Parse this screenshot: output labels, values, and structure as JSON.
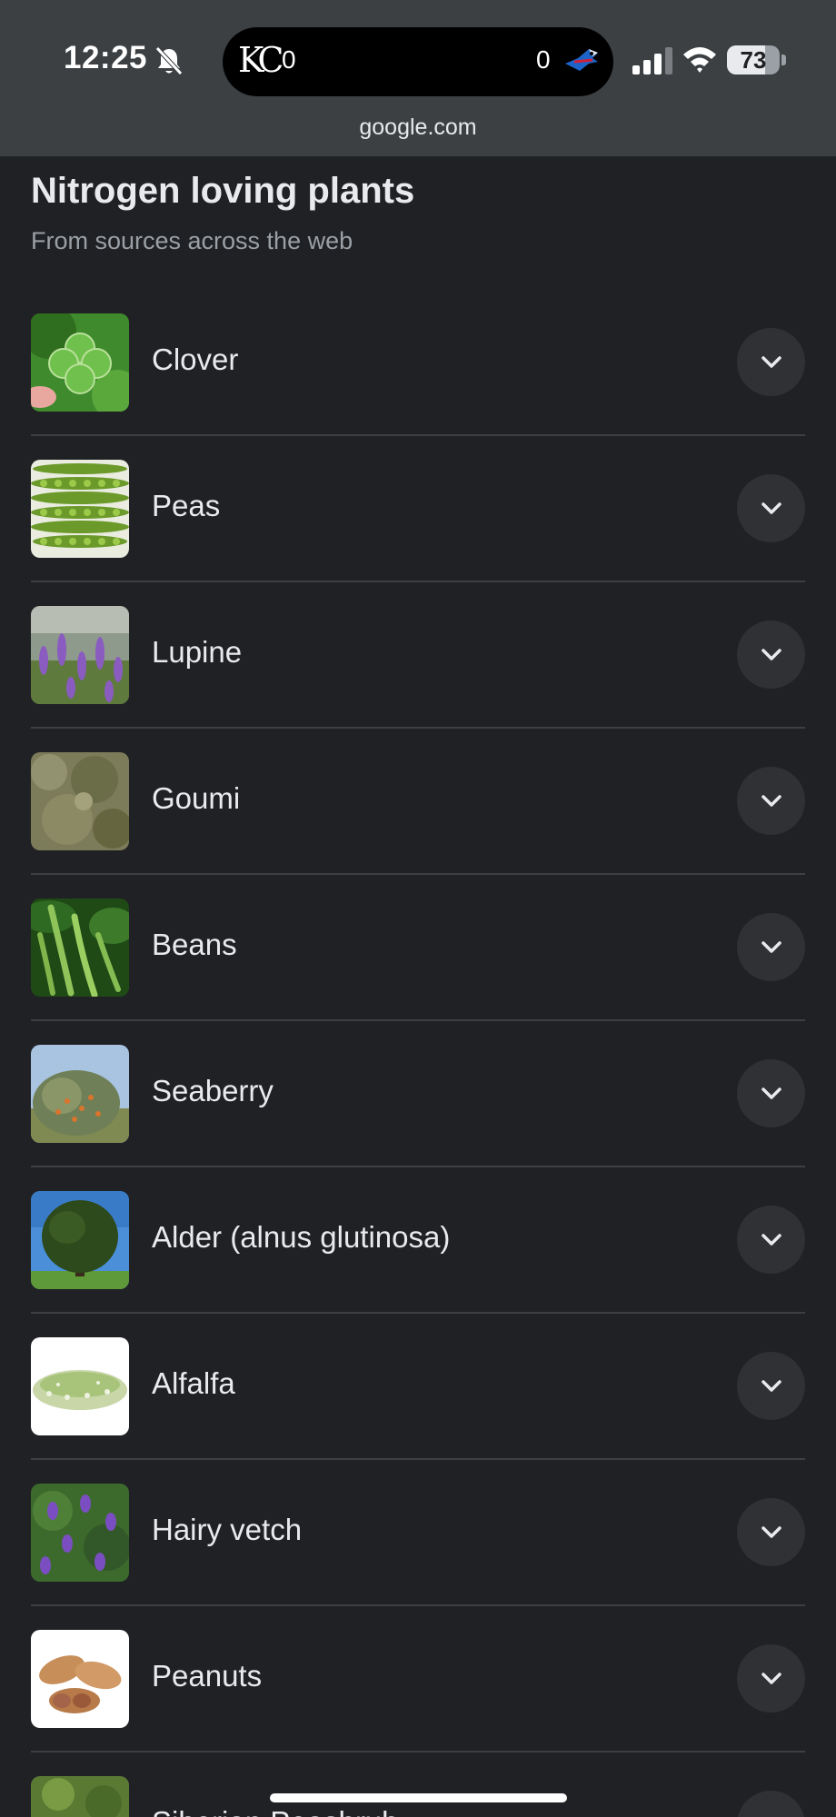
{
  "status_bar": {
    "time": "12:25",
    "live_activity": {
      "team_left_logo": "KC",
      "team_left_score": "0",
      "team_right_score": "0"
    },
    "battery": {
      "percent_text": "73",
      "level": 0.73
    },
    "url": "google.com"
  },
  "header": {
    "title": "Nitrogen loving plants",
    "subtitle": "From sources across the web"
  },
  "items": [
    {
      "label": "Clover"
    },
    {
      "label": "Peas"
    },
    {
      "label": "Lupine"
    },
    {
      "label": "Goumi"
    },
    {
      "label": "Beans"
    },
    {
      "label": "Seaberry"
    },
    {
      "label": "Alder (alnus glutinosa)"
    },
    {
      "label": "Alfalfa"
    },
    {
      "label": "Hairy vetch"
    },
    {
      "label": "Peanuts"
    },
    {
      "label": "Siberian Peashrub"
    }
  ],
  "colors": {
    "background": "#202124",
    "status_bar": "#3c4043",
    "text": "#e8eaed",
    "muted_text": "#9aa0a6",
    "button": "#303134"
  }
}
